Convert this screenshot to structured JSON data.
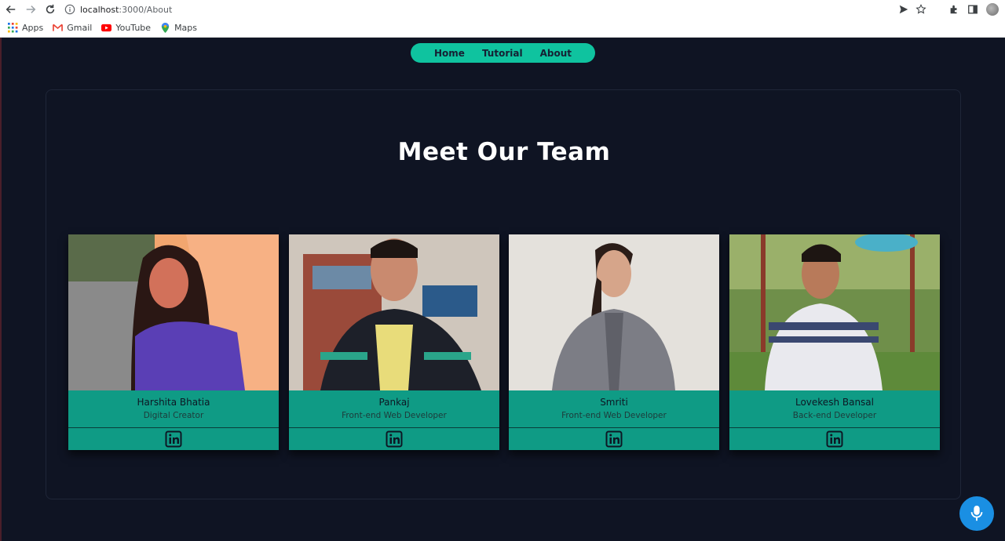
{
  "browser": {
    "url_host": "localhost",
    "url_path": ":3000/About",
    "bookmarks": [
      {
        "label": "Apps",
        "icon": "apps-grid-icon"
      },
      {
        "label": "Gmail",
        "icon": "gmail-icon"
      },
      {
        "label": "YouTube",
        "icon": "youtube-icon"
      },
      {
        "label": "Maps",
        "icon": "maps-icon"
      }
    ]
  },
  "nav": {
    "home": "Home",
    "tutorial": "Tutorial",
    "about": "About"
  },
  "page": {
    "title": "Meet Our Team"
  },
  "team": [
    {
      "name": "Harshita Bhatia",
      "role": "Digital Creator",
      "link_icon": "linkedin-icon"
    },
    {
      "name": "Pankaj",
      "role": "Front-end Web Developer",
      "link_icon": "linkedin-icon"
    },
    {
      "name": "Smriti",
      "role": "Front-end Web Developer",
      "link_icon": "linkedin-icon"
    },
    {
      "name": "Lovekesh Bansal",
      "role": "Back-end Developer",
      "link_icon": "linkedin-icon"
    }
  ],
  "colors": {
    "background": "#0f1423",
    "accent": "#0fc39f",
    "card": "#0f9b85",
    "mic": "#1a8fe3"
  }
}
